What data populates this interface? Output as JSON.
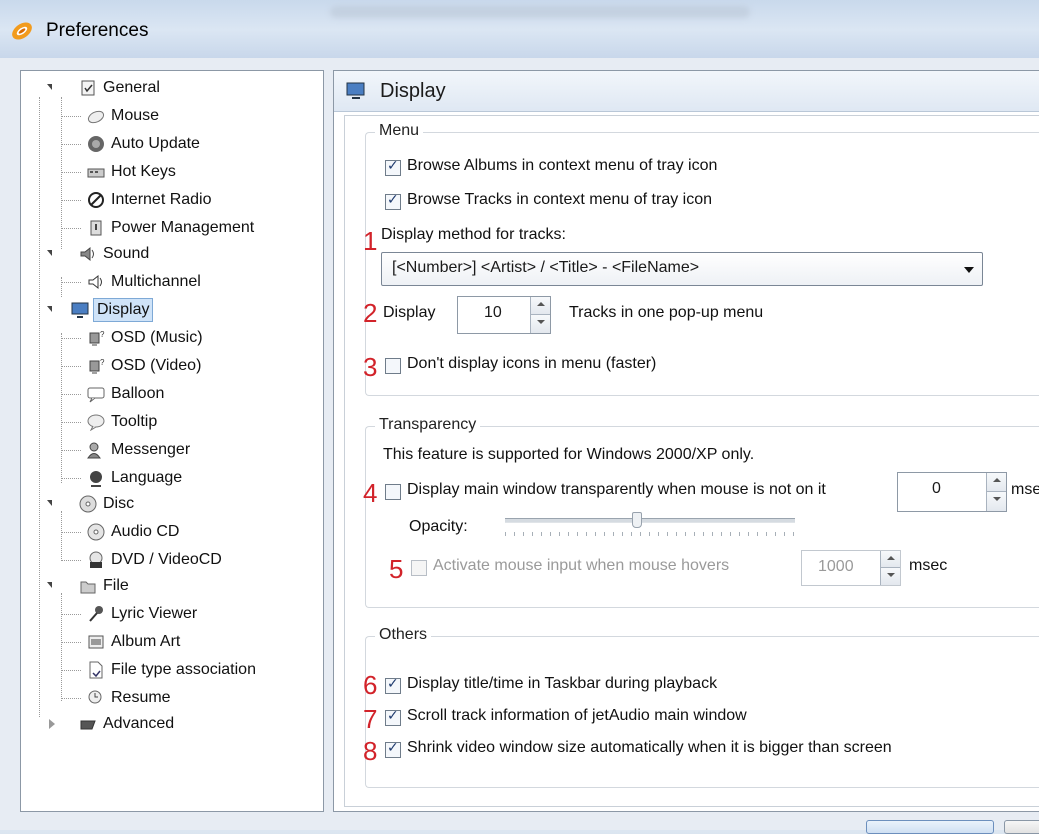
{
  "window": {
    "title": "Preferences"
  },
  "tree": {
    "items": [
      {
        "label": "General",
        "icon": "general-icon"
      },
      {
        "label": "Mouse",
        "icon": "mouse-icon"
      },
      {
        "label": "Auto Update",
        "icon": "globe-icon"
      },
      {
        "label": "Hot Keys",
        "icon": "keyboard-icon"
      },
      {
        "label": "Internet Radio",
        "icon": "radio-icon"
      },
      {
        "label": "Power Management",
        "icon": "power-icon"
      },
      {
        "label": "Sound",
        "icon": "sound-icon"
      },
      {
        "label": "Multichannel",
        "icon": "speaker-icon"
      },
      {
        "label": "Display",
        "icon": "display-icon"
      },
      {
        "label": "OSD (Music)",
        "icon": "osd-icon"
      },
      {
        "label": "OSD (Video)",
        "icon": "osd-icon"
      },
      {
        "label": "Balloon",
        "icon": "balloon-icon"
      },
      {
        "label": "Tooltip",
        "icon": "tooltip-icon"
      },
      {
        "label": "Messenger",
        "icon": "messenger-icon"
      },
      {
        "label": "Language",
        "icon": "language-icon"
      },
      {
        "label": "Disc",
        "icon": "disc-icon"
      },
      {
        "label": "Audio CD",
        "icon": "cd-icon"
      },
      {
        "label": "DVD / VideoCD",
        "icon": "dvd-icon"
      },
      {
        "label": "File",
        "icon": "file-icon"
      },
      {
        "label": "Lyric Viewer",
        "icon": "microphone-icon"
      },
      {
        "label": "Album Art",
        "icon": "album-art-icon"
      },
      {
        "label": "File type association",
        "icon": "file-association-icon"
      },
      {
        "label": "Resume",
        "icon": "resume-icon"
      },
      {
        "label": "Advanced",
        "icon": "advanced-icon"
      }
    ],
    "selected": "Display"
  },
  "panel": {
    "title": "Display",
    "menu": {
      "group_title": "Menu",
      "browse_albums": "Browse Albums in context menu of tray icon",
      "browse_tracks": "Browse Tracks in context menu of tray icon",
      "display_method_label": "Display method for tracks:",
      "display_method_value": "[<Number>] <Artist> / <Title> - <FileName>",
      "display_label": "Display",
      "tracks_count": "10",
      "tracks_suffix": "Tracks in one pop-up menu",
      "no_icons": "Don't display icons in menu (faster)"
    },
    "transparency": {
      "group_title": "Transparency",
      "note": "This feature is supported for Windows 2000/XP only.",
      "transparent_label": "Display main window transparently when mouse is not on it",
      "transparent_value": "0",
      "transparent_unit": "msec",
      "opacity_label": "Opacity:",
      "opacity_level": 0.45,
      "activate_label": "Activate mouse input when mouse hovers",
      "activate_value": "1000",
      "activate_unit": "msec"
    },
    "others": {
      "group_title": "Others",
      "title_time": "Display title/time in Taskbar during playback",
      "scroll_track": "Scroll track information of jetAudio main window",
      "shrink_video": "Shrink video window size automatically when it is bigger than screen"
    },
    "annotations": [
      "1",
      "2",
      "3",
      "4",
      "5",
      "6",
      "7",
      "8"
    ]
  },
  "checked": {
    "browse_albums": true,
    "browse_tracks": true,
    "no_icons": false,
    "transparent": false,
    "activate": false,
    "title_time": true,
    "scroll_track": true,
    "shrink_video": true
  }
}
